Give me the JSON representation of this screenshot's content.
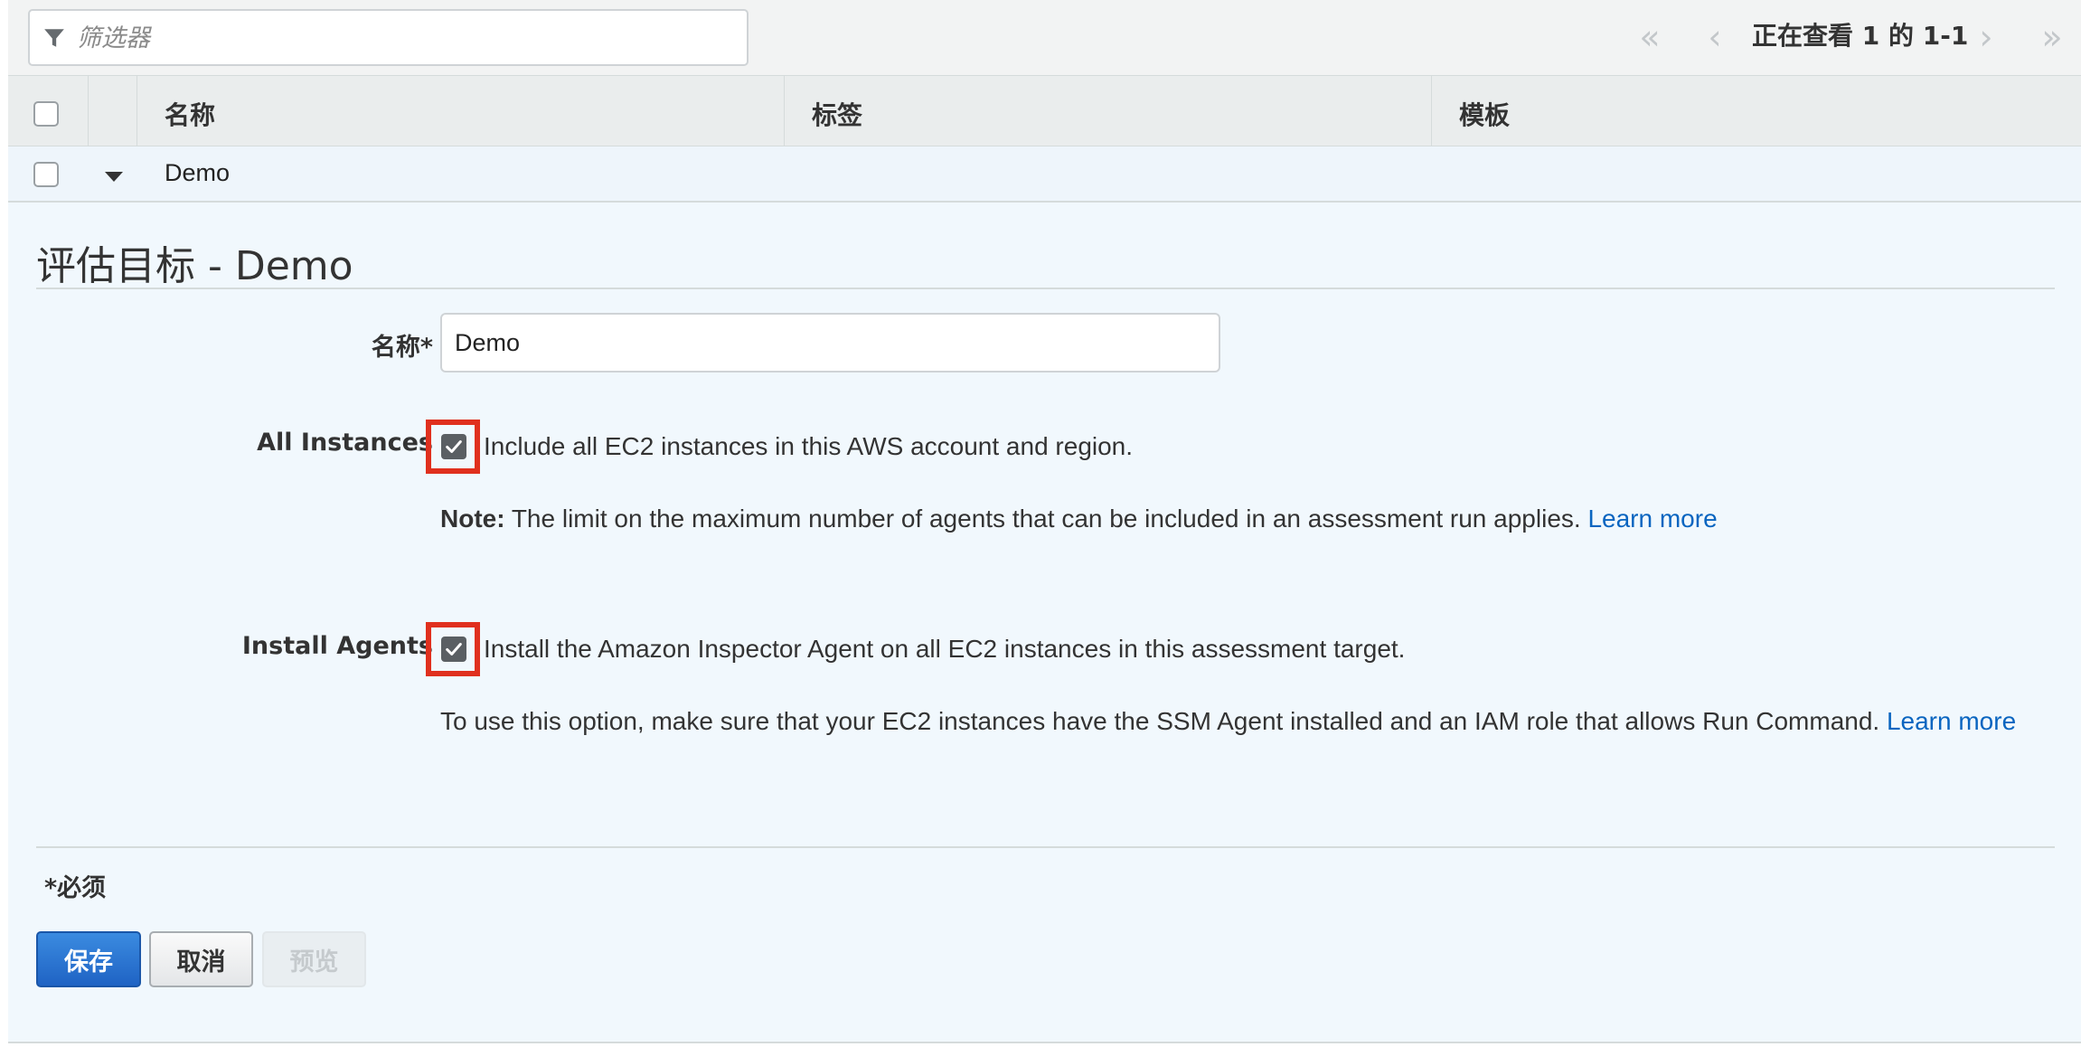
{
  "toolbar": {
    "filter_placeholder": "筛选器",
    "pager": {
      "first": "«",
      "prev": "‹",
      "status": "正在查看 1 的 1-1",
      "next": "›",
      "last": "»"
    }
  },
  "table": {
    "columns": [
      "名称",
      "标签",
      "模板"
    ],
    "rows": [
      {
        "name": "Demo",
        "expanded": true
      }
    ]
  },
  "detail": {
    "title": "评估目标 - Demo",
    "name_label": "名称*",
    "name_value": "Demo",
    "all_instances": {
      "label": "All Instances",
      "checked": true,
      "description": "Include all EC2 instances in this AWS account and region.",
      "note_prefix": "Note:",
      "note_text": " The limit on the maximum number of agents that can be included in an assessment run applies. ",
      "learn_more": "Learn more"
    },
    "install_agents": {
      "label": "Install Agents",
      "checked": true,
      "description": "Install the Amazon Inspector Agent on all EC2 instances in this assessment target.",
      "note_text": "To use this option, make sure that your EC2 instances have the SSM Agent installed and an IAM role that allows Run Command. ",
      "learn_more": "Learn more"
    },
    "required_note": "*必须",
    "buttons": {
      "save": "保存",
      "cancel": "取消",
      "preview": "预览"
    }
  },
  "colors": {
    "primary_button": "#1f63c4",
    "link": "#0a65c0",
    "highlight": "#e0301e",
    "panel_background": "#f1f8fd"
  }
}
